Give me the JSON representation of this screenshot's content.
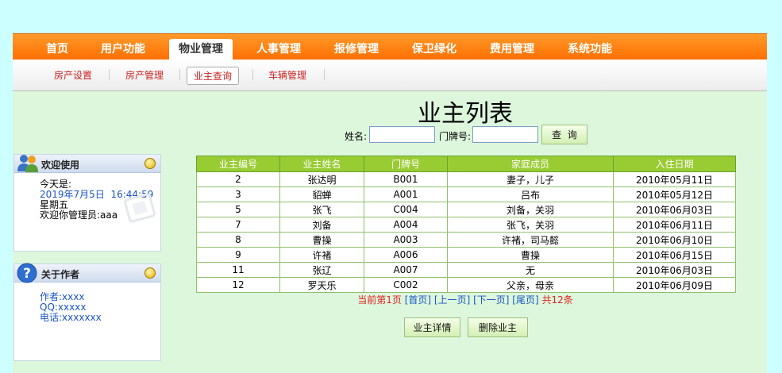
{
  "topnav": {
    "items": [
      "首页",
      "用户功能",
      "物业管理",
      "人事管理",
      "报修管理",
      "保卫绿化",
      "费用管理",
      "系统功能"
    ]
  },
  "subnav": {
    "items": [
      "房产设置",
      "房产管理",
      "业主查询",
      "车辆管理"
    ]
  },
  "welcome": {
    "title": "欢迎使用",
    "today_label": "今天是:",
    "datetime": "2019年7月5日  16:44:59",
    "weekday": "星期五",
    "greeting": "欢迎你管理员:aaa"
  },
  "about": {
    "title": "关于作者",
    "author": "作者:xxxx",
    "qq": "QQ:xxxxx",
    "phone": "电话:xxxxxxx"
  },
  "main": {
    "title": "业主列表",
    "name_label": "姓名:",
    "door_label": "门牌号:",
    "query_label": "查  询",
    "name_value": "",
    "door_value": ""
  },
  "table": {
    "headers": [
      "业主编号",
      "业主姓名",
      "门牌号",
      "家庭成员",
      "入住日期"
    ],
    "rows": [
      [
        "2",
        "张达明",
        "B001",
        "妻子，儿子",
        "2010年05月11日"
      ],
      [
        "3",
        "貂蝉",
        "A001",
        "吕布",
        "2010年05月12日"
      ],
      [
        "5",
        "张飞",
        "C004",
        "刘备，关羽",
        "2010年06月03日"
      ],
      [
        "7",
        "刘备",
        "A004",
        "张飞，关羽",
        "2010年06月11日"
      ],
      [
        "8",
        "曹操",
        "A003",
        "许褚，司马懿",
        "2010年06月10日"
      ],
      [
        "9",
        "许褚",
        "A006",
        "曹操",
        "2010年06月15日"
      ],
      [
        "11",
        "张辽",
        "A007",
        "无",
        "2010年06月03日"
      ],
      [
        "12",
        "罗天乐",
        "C002",
        "父亲，母亲",
        "2010年06月09日"
      ]
    ]
  },
  "pager": {
    "current": "当前第1页",
    "first": "[首页]",
    "prev": "[上一页]",
    "next": "[下一页]",
    "last": "[尾页]",
    "total": "共12条"
  },
  "actions": {
    "detail": "业主详情",
    "delete": "删除业主"
  }
}
